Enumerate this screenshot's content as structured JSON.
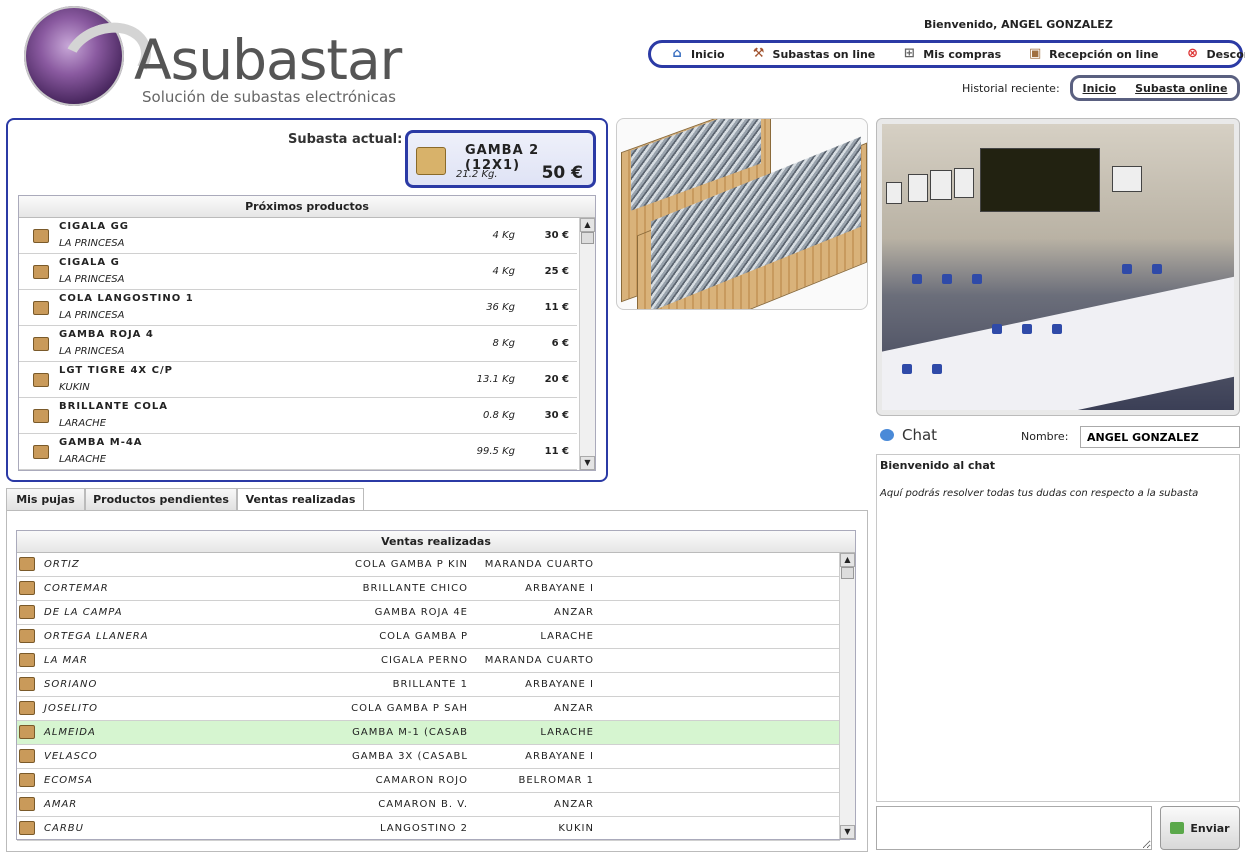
{
  "logo": {
    "brand": "Asubastar",
    "tagline": "Solución de subastas electrónicas"
  },
  "header": {
    "welcome": "Bienvenido,  ANGEL GONZALEZ",
    "nav": [
      {
        "label": "Inicio",
        "icon": "home-icon"
      },
      {
        "label": "Subastas on line",
        "icon": "gavel-icon"
      },
      {
        "label": "Mis compras",
        "icon": "cart-icon"
      },
      {
        "label": "Recepción on line",
        "icon": "box-icon"
      },
      {
        "label": "Desconectar",
        "icon": "disconnect-icon"
      }
    ],
    "history_label": "Historial reciente:",
    "history": [
      "Inicio",
      "Subasta online"
    ]
  },
  "current_auction": {
    "label": "Subasta actual:",
    "product": "GAMBA 2 (12X1)",
    "weight": "21.2 Kg.",
    "price": "50 €"
  },
  "next_products": {
    "title": "Próximos productos",
    "rows": [
      {
        "name": "CIGALA GG",
        "vendor": "LA PRINCESA",
        "weight": "4 Kg",
        "price": "30 €"
      },
      {
        "name": "CIGALA G",
        "vendor": "LA PRINCESA",
        "weight": "4 Kg",
        "price": "25 €"
      },
      {
        "name": "COLA LANGOSTINO 1",
        "vendor": "LA PRINCESA",
        "weight": "36 Kg",
        "price": "11 €"
      },
      {
        "name": "GAMBA ROJA 4",
        "vendor": "LA PRINCESA",
        "weight": "8 Kg",
        "price": "6 €"
      },
      {
        "name": "LGT TIGRE 4X C/P",
        "vendor": "KUKIN",
        "weight": "13.1 Kg",
        "price": "20 €"
      },
      {
        "name": "BRILLANTE COLA",
        "vendor": "LARACHE",
        "weight": "0.8 Kg",
        "price": "30 €"
      },
      {
        "name": "GAMBA M-4A",
        "vendor": "LARACHE",
        "weight": "99.5 Kg",
        "price": "11 €"
      }
    ]
  },
  "tabs": [
    {
      "label": "Mis pujas",
      "active": false
    },
    {
      "label": "Productos pendientes",
      "active": false
    },
    {
      "label": "Ventas realizadas",
      "active": true
    }
  ],
  "sales": {
    "title": "Ventas realizadas",
    "rows": [
      {
        "buyer": "ORTIZ",
        "product": "COLA GAMBA P KIN",
        "seller": "MARANDA CUARTO"
      },
      {
        "buyer": "CORTEMAR",
        "product": "BRILLANTE CHICO",
        "seller": "ARBAYANE I"
      },
      {
        "buyer": "DE LA CAMPA",
        "product": "GAMBA ROJA 4E",
        "seller": "ANZAR"
      },
      {
        "buyer": "ORTEGA LLANERA",
        "product": "COLA GAMBA P",
        "seller": "LARACHE"
      },
      {
        "buyer": "LA MAR",
        "product": "CIGALA PERNO",
        "seller": "MARANDA CUARTO"
      },
      {
        "buyer": "SORIANO",
        "product": "BRILLANTE 1",
        "seller": "ARBAYANE I"
      },
      {
        "buyer": "JOSELITO",
        "product": "COLA GAMBA P SAH",
        "seller": "ANZAR"
      },
      {
        "buyer": "ALMEIDA",
        "product": "GAMBA M-1 (CASAB",
        "seller": "LARACHE",
        "highlight": true
      },
      {
        "buyer": "VELASCO",
        "product": "GAMBA 3X (CASABL",
        "seller": "ARBAYANE I"
      },
      {
        "buyer": "ECOMSA",
        "product": "CAMARON ROJO",
        "seller": "BELROMAR 1"
      },
      {
        "buyer": "AMAR",
        "product": "CAMARON B. V.",
        "seller": "ANZAR"
      },
      {
        "buyer": "CARBU",
        "product": "LANGOSTINO 2",
        "seller": "KUKIN"
      }
    ]
  },
  "chat": {
    "title": "Chat",
    "name_label": "Nombre:",
    "name_value": "ANGEL GONZALEZ",
    "welcome": "Bienvenido al chat",
    "message": "Aquí podrás resolver todas tus dudas con respecto a la subasta",
    "send_label": "Enviar"
  }
}
